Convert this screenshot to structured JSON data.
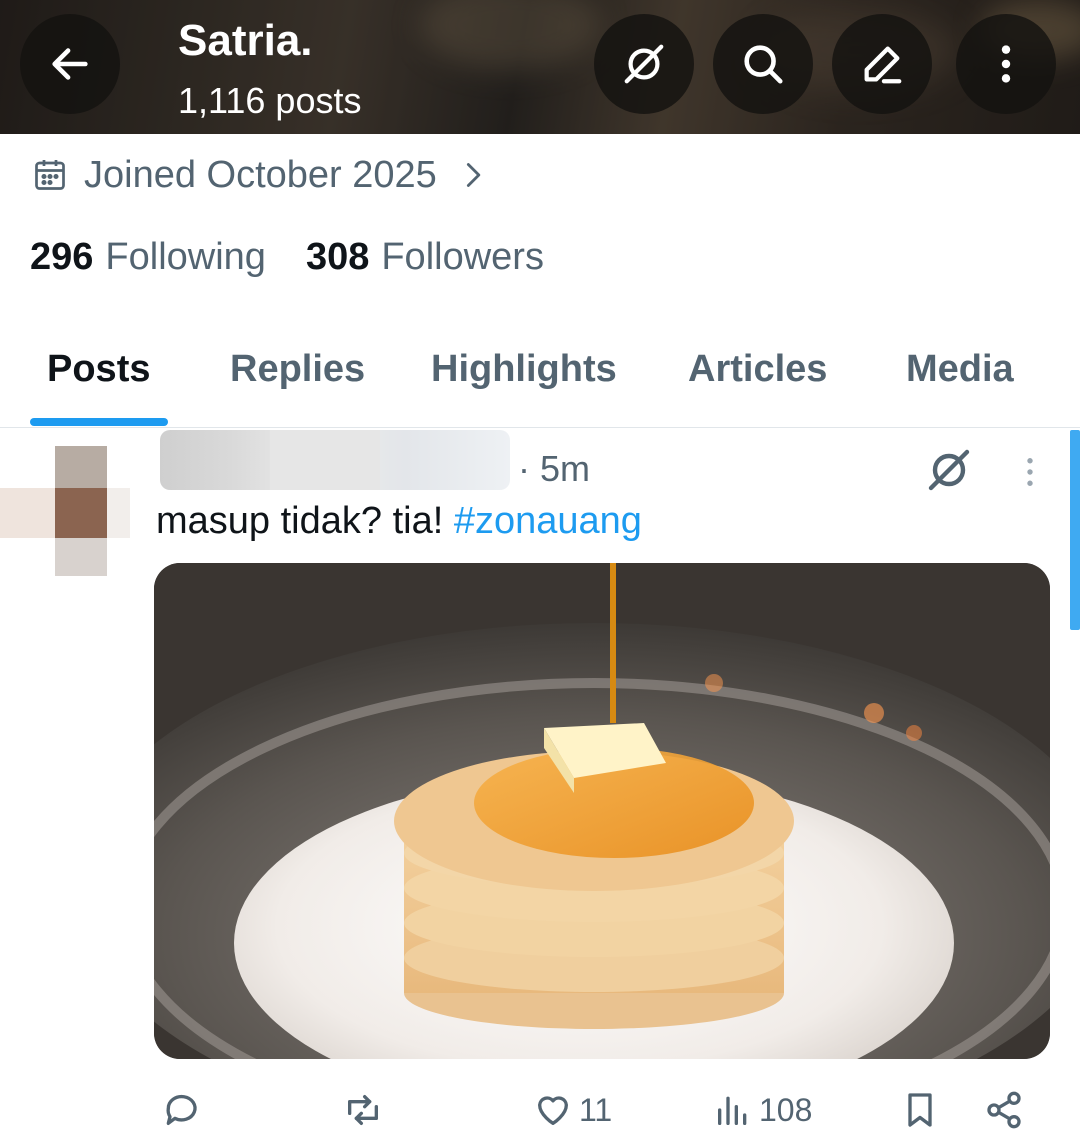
{
  "header": {
    "profile_name": "Satria.",
    "post_count": "1,116 posts",
    "icons": [
      "back-arrow-icon",
      "grok-icon",
      "search-icon",
      "compose-icon",
      "more-vertical-icon"
    ]
  },
  "profile": {
    "joined": "Joined October 2025",
    "following_count": "296",
    "following_label": "Following",
    "followers_count": "308",
    "followers_label": "Followers"
  },
  "tabs": [
    {
      "label": "Posts",
      "active": true
    },
    {
      "label": "Replies",
      "active": false
    },
    {
      "label": "Highlights",
      "active": false
    },
    {
      "label": "Articles",
      "active": false
    },
    {
      "label": "Media",
      "active": false
    }
  ],
  "post": {
    "time": "· 5m",
    "text": "masup tidak? tia! ",
    "hashtag": "#zonauang",
    "image_description_icon": "pancake-stack-image",
    "actions": {
      "replies": "",
      "reposts": "",
      "likes": "11",
      "views": "108"
    }
  },
  "colors": {
    "accent": "#1d9bf0",
    "text_primary": "#0f1419",
    "text_secondary": "#536471"
  }
}
